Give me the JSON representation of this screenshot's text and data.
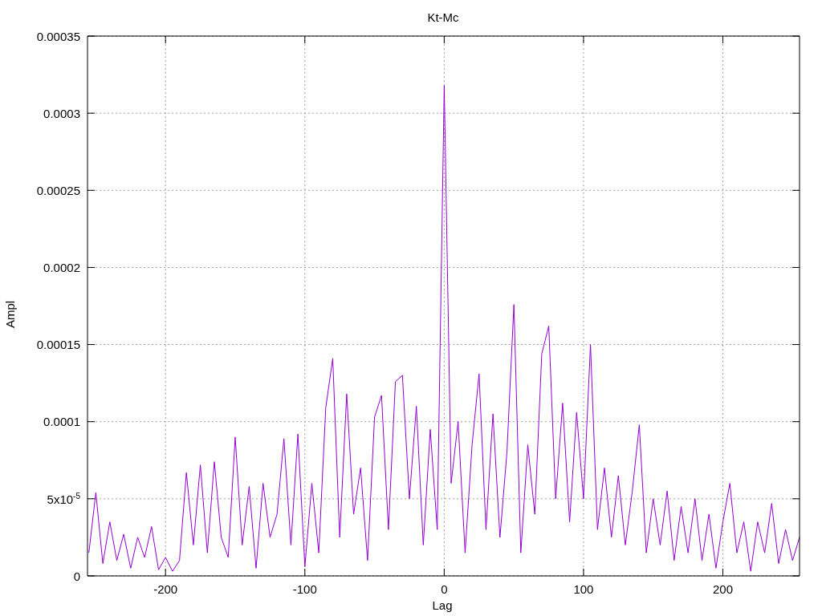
{
  "chart": {
    "chart_data": {
      "type": "line",
      "title": "Kt-Mc",
      "xlabel": "Lag",
      "ylabel": "Ampl",
      "xlim": [
        -256,
        255
      ],
      "grid": true,
      "ylim": [
        0,
        0.00035
      ],
      "xticks": [
        -200,
        -100,
        0,
        100,
        200
      ],
      "yticks": [
        {
          "value": 0,
          "label": "0"
        },
        {
          "value": 5e-05,
          "label": "5x10$^{-5}$"
        },
        {
          "value": 0.0001,
          "label": "0.0001"
        },
        {
          "value": 0.00015,
          "label": "0.00015"
        },
        {
          "value": 0.0002,
          "label": "0.0002"
        },
        {
          "value": 0.00025,
          "label": "0.00025"
        },
        {
          "value": 0.0003,
          "label": "0.0003"
        },
        {
          "value": 0.00035,
          "label": "0.00035"
        }
      ],
      "x": [
        -255,
        -250,
        -245,
        -240,
        -235,
        -230,
        -225,
        -220,
        -215,
        -210,
        -205,
        -200,
        -195,
        -190,
        -185,
        -180,
        -175,
        -170,
        -165,
        -160,
        -155,
        -150,
        -145,
        -140,
        -135,
        -130,
        -125,
        -120,
        -115,
        -110,
        -105,
        -100,
        -95,
        -90,
        -85,
        -80,
        -75,
        -70,
        -65,
        -60,
        -55,
        -50,
        -45,
        -40,
        -35,
        -30,
        -25,
        -20,
        -15,
        -10,
        -5,
        0,
        5,
        10,
        15,
        20,
        25,
        30,
        35,
        40,
        45,
        50,
        55,
        60,
        65,
        70,
        75,
        80,
        85,
        90,
        95,
        100,
        105,
        110,
        115,
        120,
        125,
        130,
        135,
        140,
        145,
        150,
        155,
        160,
        165,
        170,
        175,
        180,
        185,
        190,
        195,
        200,
        205,
        210,
        215,
        220,
        225,
        230,
        235,
        240,
        245,
        250,
        255
      ],
      "series": [
        {
          "color": "#9400d3",
          "values": [
            1.5e-05,
            5.4e-05,
            8e-06,
            3.5e-05,
            1e-05,
            2.7e-05,
            5e-06,
            2.5e-05,
            1.2e-05,
            3.2e-05,
            4e-06,
            1.2e-05,
            3e-06,
            1e-05,
            6.7e-05,
            2e-05,
            7.2e-05,
            1.5e-05,
            7.4e-05,
            2.5e-05,
            1.2e-05,
            9e-05,
            2e-05,
            5.8e-05,
            5e-06,
            6e-05,
            2.5e-05,
            4e-05,
            8.9e-05,
            2e-05,
            9.2e-05,
            6e-06,
            6e-05,
            1.5e-05,
            0.000109,
            0.000141,
            2.5e-05,
            0.000118,
            4e-05,
            7e-05,
            1e-05,
            0.000103,
            0.000117,
            3e-05,
            0.000126,
            0.00013,
            5e-05,
            0.00011,
            2e-05,
            9.5e-05,
            3e-05,
            0.000318,
            6e-05,
            0.0001,
            1.5e-05,
            8.5e-05,
            0.000131,
            3e-05,
            0.000105,
            2.5e-05,
            8e-05,
            0.000176,
            1.5e-05,
            8.5e-05,
            4e-05,
            0.000144,
            0.000162,
            5e-05,
            0.000112,
            3.5e-05,
            0.000106,
            5e-05,
            0.00015,
            3e-05,
            7e-05,
            2.5e-05,
            6.5e-05,
            2e-05,
            5.5e-05,
            9.8e-05,
            1.5e-05,
            5e-05,
            2e-05,
            5.5e-05,
            1e-05,
            4.5e-05,
            1.5e-05,
            5e-05,
            1e-05,
            4e-05,
            5e-06,
            3.5e-05,
            6e-05,
            1.5e-05,
            3.5e-05,
            3e-06,
            3.5e-05,
            1.5e-05,
            4.7e-05,
            8e-06,
            3e-05,
            1e-05,
            2.5e-05
          ]
        }
      ]
    }
  }
}
